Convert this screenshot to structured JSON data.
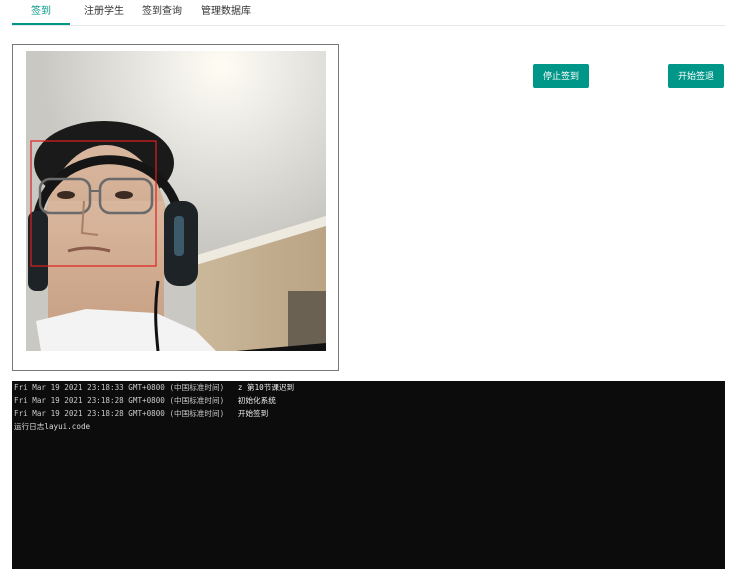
{
  "tabs": [
    {
      "label": "签到",
      "active": true
    },
    {
      "label": "注册学生",
      "active": false
    },
    {
      "label": "签到查询",
      "active": false
    },
    {
      "label": "管理数据库",
      "active": false
    }
  ],
  "buttons": {
    "stop": "停止签到",
    "start": "开始签退"
  },
  "log": {
    "lines": [
      {
        "time": "Fri Mar 19 2021 23:18:33 GMT+0800 (中国标准时间)",
        "message": "z 第10节课迟到"
      },
      {
        "time": "Fri Mar 19 2021 23:18:28 GMT+0800 (中国标准时间)",
        "message": "初始化系统"
      },
      {
        "time": "Fri Mar 19 2021 23:18:28 GMT+0800 (中国标准时间)",
        "message": "开始签到"
      }
    ],
    "footer": "运行日志layui.code"
  },
  "colors": {
    "accent": "#009688",
    "console_bg": "#0c0c0c",
    "face_box": "#e02020"
  }
}
